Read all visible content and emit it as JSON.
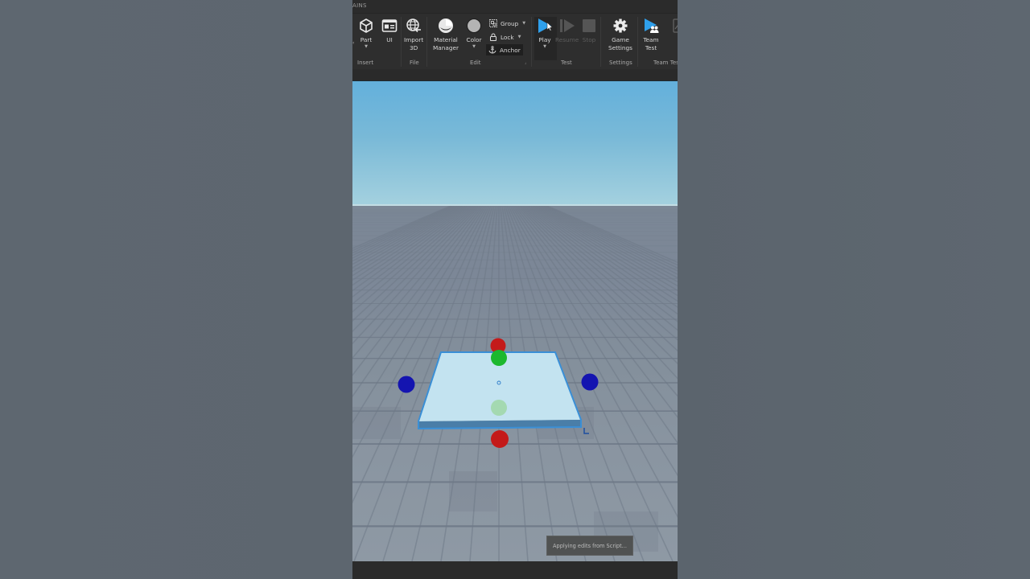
{
  "app": {
    "tab_fragment": "AINS"
  },
  "ribbon": {
    "tools": {
      "part": {
        "label": "Part",
        "icon": "cube-icon",
        "has_dropdown": true
      },
      "ui": {
        "label": "UI",
        "icon": "ui-window-icon"
      },
      "import3d": {
        "label_line1": "Import",
        "label_line2": "3D",
        "icon": "globe-import-icon"
      },
      "material_manager": {
        "label_line1": "Material",
        "label_line2": "Manager",
        "icon": "material-sphere-icon"
      },
      "color": {
        "label": "Color",
        "icon": "color-circle-icon",
        "has_dropdown": true
      },
      "group": {
        "label": "Group",
        "icon": "group-icon",
        "has_dropdown": true
      },
      "lock": {
        "label": "Lock",
        "icon": "lock-icon",
        "has_dropdown": true
      },
      "anchor": {
        "label": "Anchor",
        "icon": "anchor-icon",
        "active": true
      },
      "play": {
        "label": "Play",
        "icon": "play-icon",
        "has_dropdown": true
      },
      "resume": {
        "label": "Resume",
        "icon": "resume-icon",
        "disabled": true
      },
      "stop": {
        "label": "Stop",
        "icon": "stop-icon",
        "disabled": true
      },
      "game_settings": {
        "label_line1": "Game",
        "label_line2": "Settings",
        "icon": "gear-icon"
      },
      "team_test": {
        "label_line1": "Team",
        "label_line2": "Test",
        "icon": "team-test-icon"
      }
    },
    "groups": {
      "insert": "Insert",
      "file": "File",
      "edit": "Edit",
      "test": "Test",
      "settings": "Settings",
      "team_test": "Team Test"
    },
    "colors": {
      "accent_blue": "#2fa0ec",
      "background": "#2e2e2e",
      "label_text": "#d8d8d8"
    }
  },
  "viewport": {
    "selected_part": {
      "name": "part",
      "selection_color": "#3a8fd6",
      "handles": {
        "y_axis_color": "#c41a1a",
        "z_axis_color": "#1cb82e",
        "x_axis_color": "#1414b0"
      }
    }
  },
  "toast": {
    "message": "Applying edits from Script..."
  }
}
